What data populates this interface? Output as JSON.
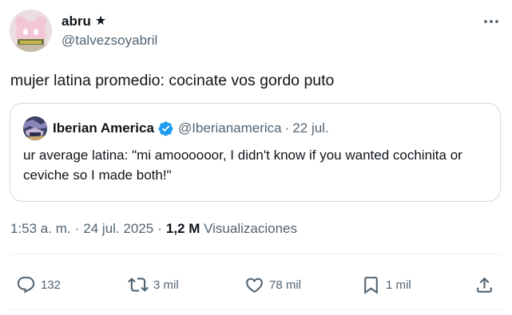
{
  "author": {
    "display_name": "abru",
    "name_badge": "★",
    "handle": "@talvezsoyabril"
  },
  "tweet": {
    "text": "mujer latina promedio: cocinate vos gordo puto"
  },
  "quoted_tweet": {
    "display_name": "Iberian America",
    "handle": "@Iberianamerica",
    "separator": "·",
    "date": "22 jul.",
    "text": "ur average latina: \"mi amoooooor, I didn't know if you wanted cochinita or ceviche so I made both!\""
  },
  "meta": {
    "time": "1:53 a. m.",
    "separator": "·",
    "date": "24 jul. 2025",
    "views_count": "1,2 M",
    "views_label": "Visualizaciones"
  },
  "actions": {
    "replies": "132",
    "reposts": "3 mil",
    "likes": "78 mil",
    "bookmarks": "1 mil"
  },
  "icons": {
    "more": "more-horizontal-icon",
    "verified": "verified-badge-icon",
    "reply": "reply-icon",
    "repost": "repost-icon",
    "like": "heart-icon",
    "bookmark": "bookmark-icon",
    "share": "share-icon"
  },
  "colors": {
    "text_primary": "#0f1419",
    "text_secondary": "#536471",
    "border": "#cfd9de",
    "verified": "#1d9bf0"
  }
}
